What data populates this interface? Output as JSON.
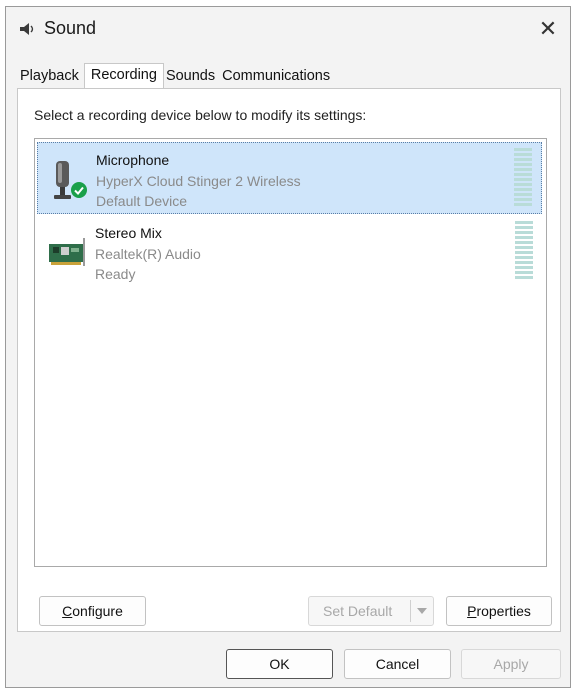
{
  "window": {
    "title": "Sound",
    "close_glyph": "✕"
  },
  "tabs": [
    {
      "label": "Playback",
      "active": false
    },
    {
      "label": "Recording",
      "active": true
    },
    {
      "label": "Sounds",
      "active": false
    },
    {
      "label": "Communications",
      "active": false
    }
  ],
  "recording": {
    "instruction": "Select a recording device below to modify its settings:",
    "devices": [
      {
        "name": "Microphone",
        "subtitle": "HyperX Cloud Stinger 2 Wireless",
        "status": "Default Device",
        "selected": true,
        "icon": "microphone-icon",
        "default_badge": "checkmark-badge-icon"
      },
      {
        "name": "Stereo Mix",
        "subtitle": "Realtek(R) Audio",
        "status": "Ready",
        "selected": false,
        "icon": "sound-card-icon"
      }
    ]
  },
  "buttons": {
    "configure": {
      "prefix": "",
      "accel": "C",
      "rest": "onfigure"
    },
    "set_default": {
      "label": "Set Default",
      "disabled": true
    },
    "properties": {
      "prefix": "",
      "accel": "P",
      "rest": "roperties"
    },
    "ok": "OK",
    "cancel": "Cancel",
    "apply": {
      "label": "Apply",
      "disabled": true
    }
  },
  "colors": {
    "selection": "#cfe5fa",
    "meter": "#b9dcd8",
    "badge": "#1aa04a"
  }
}
